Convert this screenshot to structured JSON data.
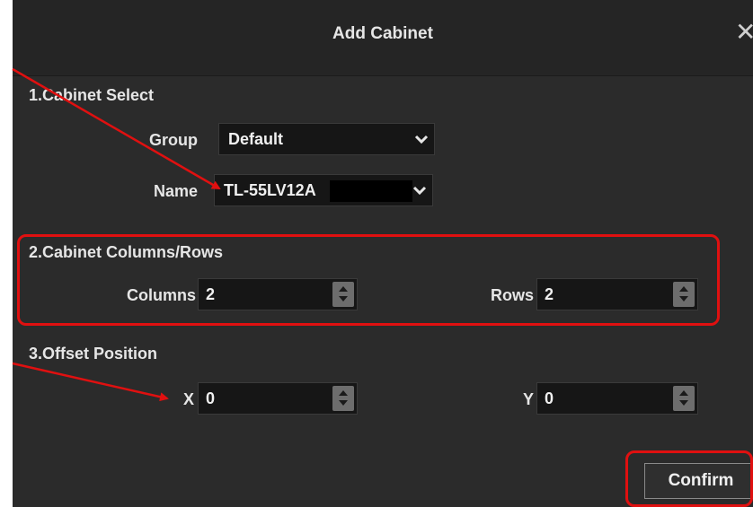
{
  "dialog": {
    "title": "Add Cabinet",
    "close_label": "✕"
  },
  "section1": {
    "title": "1.Cabinet Select",
    "group": {
      "label": "Group",
      "value": "Default"
    },
    "name": {
      "label": "Name",
      "value": "TL-55LV12A"
    }
  },
  "section2": {
    "title": "2.Cabinet Columns/Rows",
    "columns": {
      "label": "Columns",
      "value": "2"
    },
    "rows": {
      "label": "Rows",
      "value": "2"
    }
  },
  "section3": {
    "title": "3.Offset Position",
    "x": {
      "label": "X",
      "value": "0"
    },
    "y": {
      "label": "Y",
      "value": "0"
    }
  },
  "footer": {
    "confirm_label": "Confirm"
  },
  "colors": {
    "annotation": "#e01010",
    "dialog_bg": "#2b2b2b",
    "field_bg": "#161616"
  },
  "icons": {
    "dropdown": "chevron-down-icon",
    "spinner": "spinner-arrows-icon",
    "close": "close-icon"
  }
}
